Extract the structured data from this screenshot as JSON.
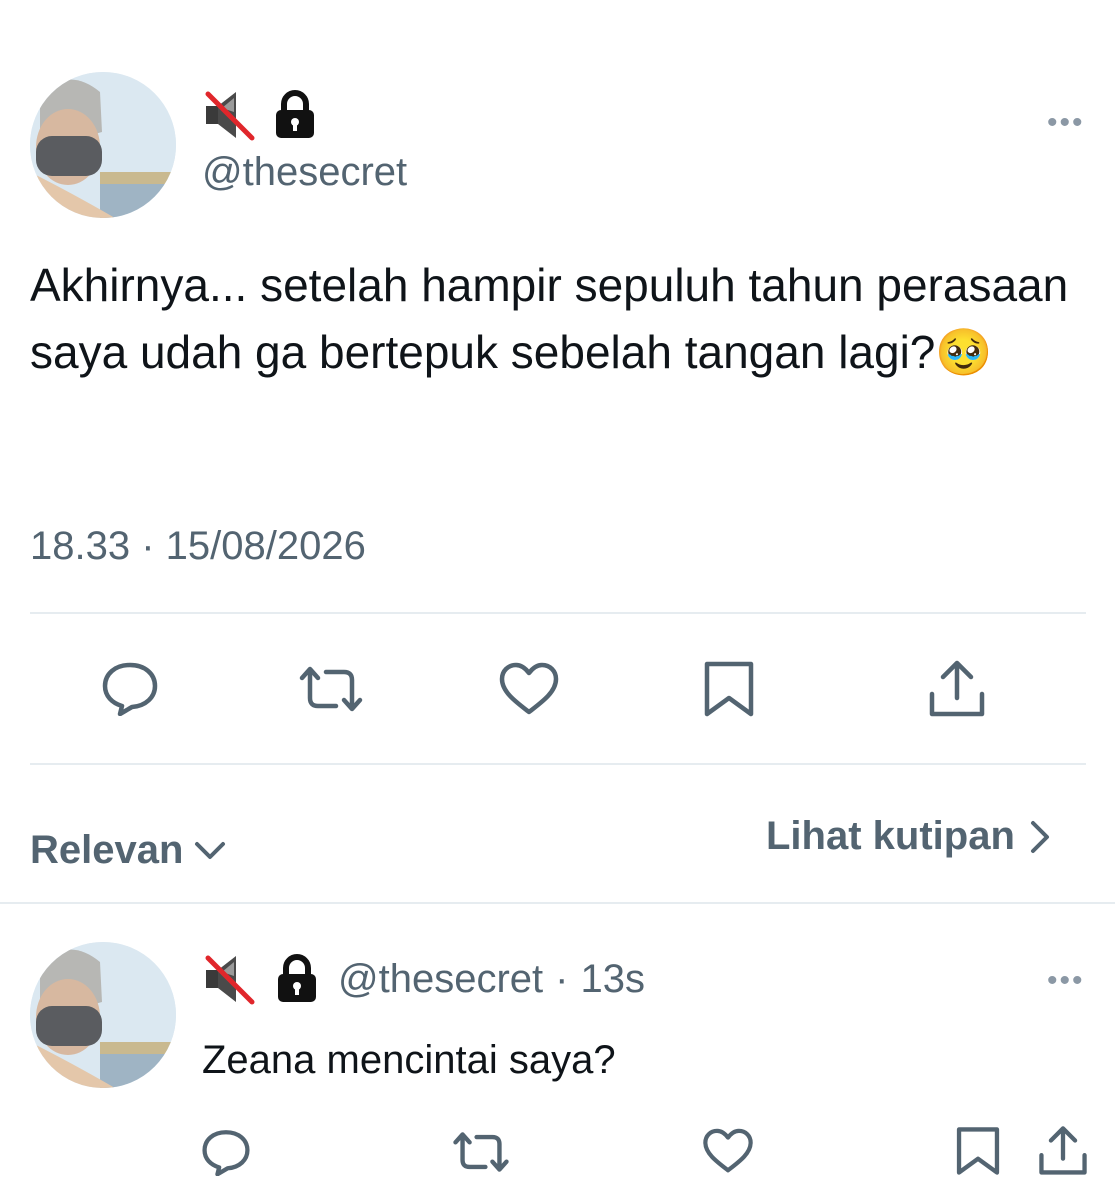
{
  "tweet": {
    "emoji_icons": [
      "muted-speaker-icon",
      "lock-icon"
    ],
    "handle": "@thesecret",
    "more": "•••",
    "text": "Akhirnya... setelah hampir sepuluh tahun perasaan saya udah ga bertepuk sebelah tangan lagi?",
    "text_emoji": "🥹",
    "timestamp": "18.33 · 15/08/2026"
  },
  "actions": [
    "reply-icon",
    "retweet-icon",
    "like-icon",
    "bookmark-icon",
    "share-icon"
  ],
  "sort": {
    "label": "Relevan",
    "quotes_label": "Lihat kutipan"
  },
  "reply": {
    "handle": "@thesecret",
    "separator": "·",
    "time": "13s",
    "more": "•••",
    "text": "Zeana mencintai saya?"
  },
  "colors": {
    "muted_text": "#536471",
    "icon": "#536471",
    "divider": "#e6ecf0",
    "text": "#0f1419"
  }
}
